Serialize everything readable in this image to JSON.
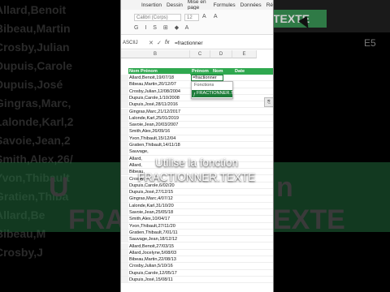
{
  "menu": [
    "Insertion",
    "Dessin",
    "Mise en page",
    "Formules",
    "Données",
    "Ré"
  ],
  "ribbon": {
    "font": "Calibri (Corps)",
    "size": "12"
  },
  "formula_bar": {
    "name_box": "ASCIIJ",
    "formula": "=fractionner"
  },
  "columns": {
    "b": "B",
    "c": "C",
    "d": "D",
    "e": "E"
  },
  "header_row": {
    "b": "Nom Prénom",
    "c": "Prénom",
    "d": "Nom",
    "e": "Date"
  },
  "editing_cell": "=fractionner",
  "autocomplete": {
    "heading": "Fonctions",
    "item": "FRACTIONNER.TEXTE"
  },
  "rows": [
    "Allard,Benoit,19/07/18",
    "Bibeau,Martin,20/12/07",
    "Crosby,Julian,12/08/2004",
    "Dupuis,Carole,1/10/2008",
    "Dupuis,José,28/11/2016",
    "Gingras,Marc,21/12/2017",
    "Lalonde,Karl,25/01/2019",
    "Savoie,Jean,20/03/2007",
    "Smith,Alex,26/09/16",
    "Yvon,Thibault,15/12/04",
    "Gratien,Thibault,14/11/18",
    "Sauvage,",
    "Allard,",
    "Allard,",
    "Bibeau,",
    "Crosby,",
    "Dupuis,Carole,6/02/20",
    "Dupuis,José,27/12/15",
    "Gingras,Marc,4/07/12",
    "Lalonde,Karl,31/10/20",
    "Savoie,Jean,25/05/18",
    "Smith,Alex,10/04/17",
    "Yvon,Thibault,27/11/20",
    "Gratien,Thibault,7/01/11",
    "Sauvage,Jean,18/12/12",
    "Allard,Benoit,27/03/15",
    "Allard,Jocelyne,5/08/03",
    "Bibeau,Martin,22/08/13",
    "Crosby,Julian,5/10/16",
    "Dupuis,Carole,12/05/17",
    "Dupuis,José,15/08/11"
  ],
  "caption": {
    "line1": "Utilise la fonction",
    "line2": "FRACTIONNER.TEXTE"
  },
  "background": {
    "left_names": [
      "Allard,Benoit",
      "Bibeau,Martin",
      "Crosby,Julian",
      "Dupuis,Carole",
      "Dupuis,José",
      "Gingras,Marc,",
      "Lalonde,Karl,2",
      "Savoie,Jean,2",
      "Smith,Alex,26/",
      "Yvon,Thibault",
      "Gratien,Thiba",
      "Allard,Be",
      "Bibeau,M",
      "Crosby,J"
    ],
    "ribbon_text": "R.TEXTE",
    "cell_ref": "E5",
    "big_left": "U",
    "big_right": "n",
    "big_bottom_left": "FRA",
    "big_bottom_right": "EXTE"
  },
  "colors": {
    "excel_green": "#1e7c3a",
    "header_green": "#2fa84f"
  }
}
